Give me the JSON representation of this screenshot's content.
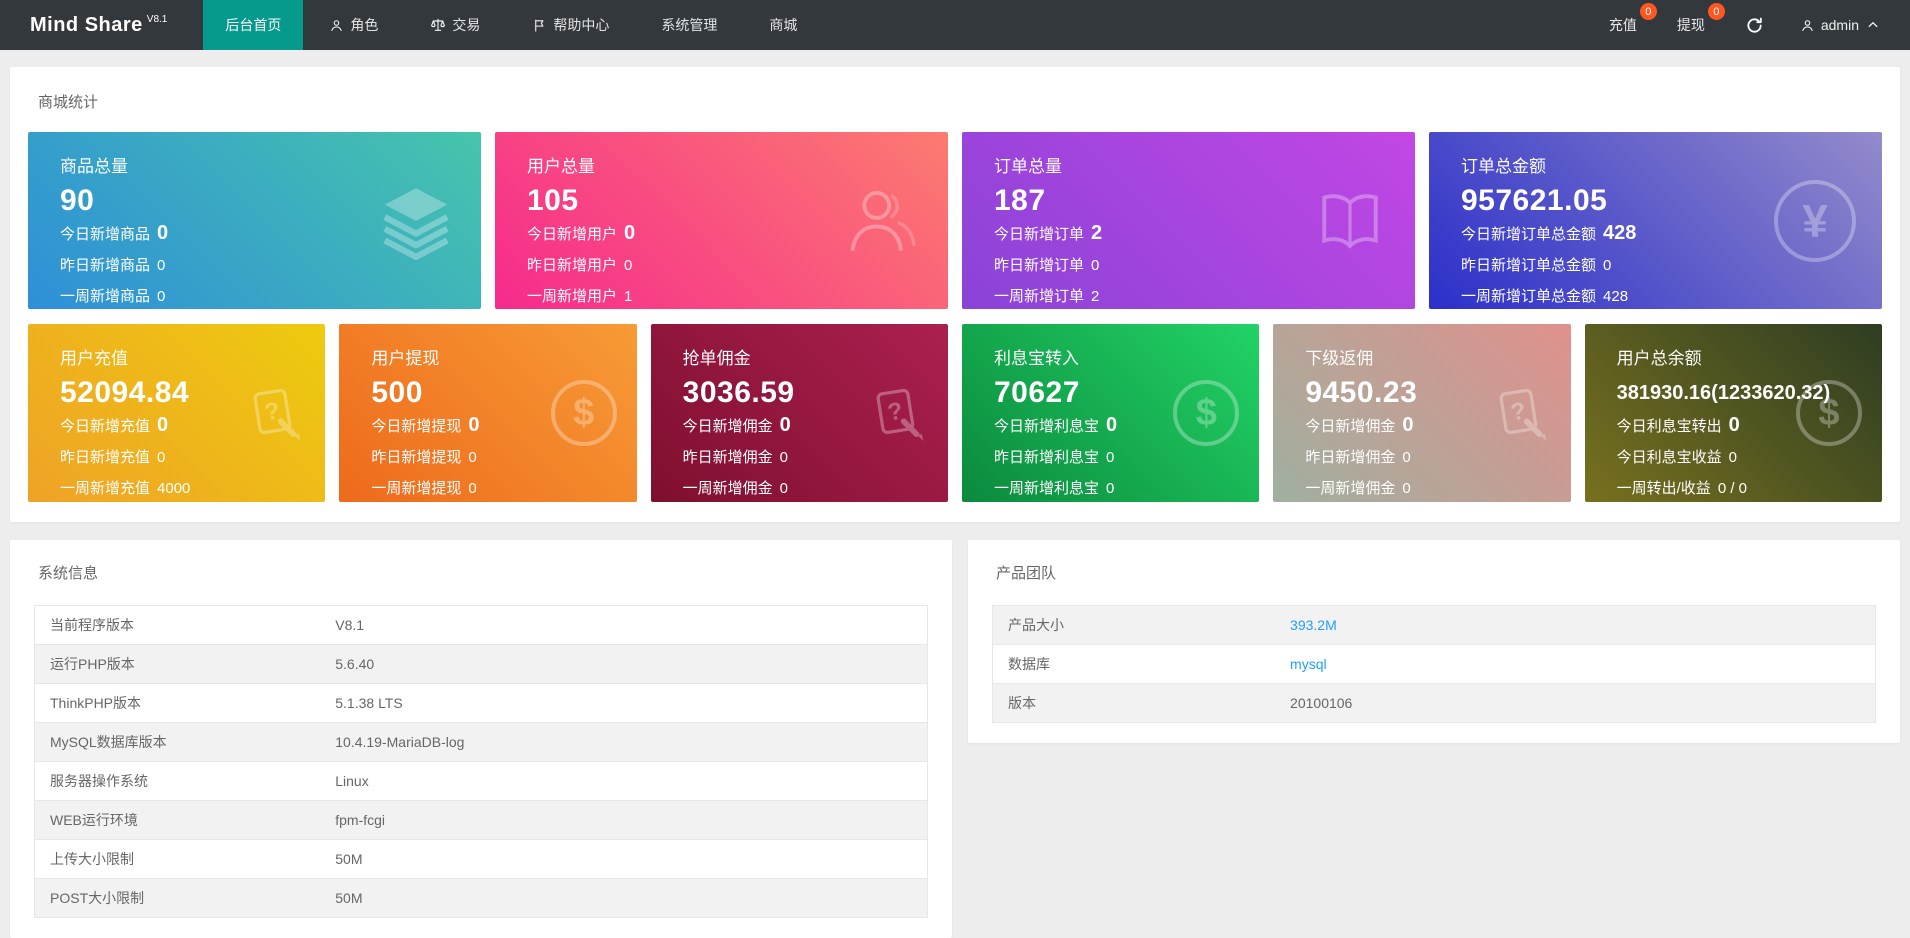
{
  "colors": {
    "navbar_bg": "#33383d",
    "nav_active_bg": "#069a8d",
    "badge_bg": "#ff5722",
    "link_blue": "#1e9fff",
    "page_bg": "#ededed"
  },
  "navbar": {
    "brand": "Mind Share",
    "brand_version": "V8.1",
    "menu": [
      {
        "name": "nav-home",
        "label": "后台首页",
        "icon": null,
        "active": true
      },
      {
        "name": "nav-roles",
        "label": "角色",
        "icon": "user",
        "active": false
      },
      {
        "name": "nav-trade",
        "label": "交易",
        "icon": "scales",
        "active": false
      },
      {
        "name": "nav-help",
        "label": "帮助中心",
        "icon": "flag",
        "active": false
      },
      {
        "name": "nav-system",
        "label": "系统管理",
        "icon": null,
        "active": false
      },
      {
        "name": "nav-mall",
        "label": "商城",
        "icon": null,
        "active": false
      }
    ],
    "actions": [
      {
        "name": "recharge",
        "label": "充值",
        "badge": "0"
      },
      {
        "name": "withdraw",
        "label": "提现",
        "badge": "0"
      }
    ],
    "user": {
      "name": "admin"
    }
  },
  "stats": {
    "title": "商城统计",
    "cards_row1": [
      {
        "name": "card-goods-total",
        "title": "商品总量",
        "value": "90",
        "icon": "layers",
        "gradient": "linear-gradient(45deg, #2e8fd8, #46c5ac)",
        "lines": [
          {
            "label": "今日新增商品",
            "value": "0",
            "strong": true
          },
          {
            "label": "昨日新增商品",
            "value": "0",
            "strong": false
          },
          {
            "label": "一周新增商品",
            "value": "0",
            "strong": false
          }
        ]
      },
      {
        "name": "card-users-total",
        "title": "用户总量",
        "value": "105",
        "icon": "users",
        "gradient": "linear-gradient(45deg, #f62a8d, #fc7b70)",
        "lines": [
          {
            "label": "今日新增用户",
            "value": "0",
            "strong": true
          },
          {
            "label": "昨日新增用户",
            "value": "0",
            "strong": false
          },
          {
            "label": "一周新增用户",
            "value": "1",
            "strong": false
          }
        ]
      },
      {
        "name": "card-orders-total",
        "title": "订单总量",
        "value": "187",
        "icon": "book",
        "gradient": "linear-gradient(45deg, #8a43d7, #c247e4)",
        "lines": [
          {
            "label": "今日新增订单",
            "value": "2",
            "strong": true
          },
          {
            "label": "昨日新增订单",
            "value": "0",
            "strong": false
          },
          {
            "label": "一周新增订单",
            "value": "2",
            "strong": false
          }
        ]
      },
      {
        "name": "card-order-amount",
        "title": "订单总金额",
        "value": "957621.05",
        "icon": "yen-circle",
        "gradient": "linear-gradient(45deg, #2b2fc9, #938bcb)",
        "lines": [
          {
            "label": "今日新增订单总金额",
            "value": "428",
            "strong": true
          },
          {
            "label": "昨日新增订单总金额",
            "value": "0",
            "strong": false
          },
          {
            "label": "一周新增订单总金额",
            "value": "428",
            "strong": false
          }
        ]
      }
    ],
    "cards_row2": [
      {
        "name": "card-user-recharge",
        "title": "用户充值",
        "value": "52094.84",
        "icon": "question-doc",
        "gradient": "linear-gradient(45deg, #efa227, #eecb0e)",
        "lines": [
          {
            "label": "今日新增充值",
            "value": "0",
            "strong": true
          },
          {
            "label": "昨日新增充值",
            "value": "0",
            "strong": false
          },
          {
            "label": "一周新增充值",
            "value": "4000",
            "strong": false
          }
        ]
      },
      {
        "name": "card-user-withdraw",
        "title": "用户提现",
        "value": "500",
        "icon": "dollar-circle",
        "gradient": "linear-gradient(45deg, #ee6a1c, #f79b36)",
        "lines": [
          {
            "label": "今日新增提现",
            "value": "0",
            "strong": true
          },
          {
            "label": "昨日新增提现",
            "value": "0",
            "strong": false
          },
          {
            "label": "一周新增提现",
            "value": "0",
            "strong": false
          }
        ]
      },
      {
        "name": "card-order-commission",
        "title": "抢单佣金",
        "value": "3036.59",
        "icon": "question-doc",
        "gradient": "linear-gradient(45deg, #7f0f2e, #ab2050)",
        "lines": [
          {
            "label": "今日新增佣金",
            "value": "0",
            "strong": true
          },
          {
            "label": "昨日新增佣金",
            "value": "0",
            "strong": false
          },
          {
            "label": "一周新增佣金",
            "value": "0",
            "strong": false
          }
        ]
      },
      {
        "name": "card-interest-in",
        "title": "利息宝转入",
        "value": "70627",
        "icon": "dollar-circle",
        "gradient": "linear-gradient(45deg, #0b8a3d, #22d366)",
        "lines": [
          {
            "label": "今日新增利息宝",
            "value": "0",
            "strong": true
          },
          {
            "label": "昨日新增利息宝",
            "value": "0",
            "strong": false
          },
          {
            "label": "一周新增利息宝",
            "value": "0",
            "strong": false
          }
        ]
      },
      {
        "name": "card-sub-rebate",
        "title": "下级返佣",
        "value": "9450.23",
        "icon": "question-doc",
        "gradient": "linear-gradient(45deg, #9fb09f, #e0918d)",
        "lines": [
          {
            "label": "今日新增佣金",
            "value": "0",
            "strong": true
          },
          {
            "label": "昨日新增佣金",
            "value": "0",
            "strong": false
          },
          {
            "label": "一周新增佣金",
            "value": "0",
            "strong": false
          }
        ]
      },
      {
        "name": "card-user-balance",
        "title": "用户总余额",
        "value": "381930.16(1233620.32)",
        "icon": "dollar-circle",
        "small_value": true,
        "gradient": "linear-gradient(45deg, #77701e, #2e3d22)",
        "lines": [
          {
            "label": "今日利息宝转出",
            "value": "0",
            "strong": true
          },
          {
            "label": "今日利息宝收益",
            "value": "0",
            "strong": false
          },
          {
            "label": "一周转出/收益",
            "value": "0 / 0",
            "strong": false
          }
        ]
      }
    ]
  },
  "system_info": {
    "title": "系统信息",
    "rows": [
      {
        "label": "当前程序版本",
        "value": "V8.1"
      },
      {
        "label": "运行PHP版本",
        "value": "5.6.40"
      },
      {
        "label": "ThinkPHP版本",
        "value": "5.1.38 LTS"
      },
      {
        "label": "MySQL数据库版本",
        "value": "10.4.19-MariaDB-log"
      },
      {
        "label": "服务器操作系统",
        "value": "Linux"
      },
      {
        "label": "WEB运行环境",
        "value": "fpm-fcgi"
      },
      {
        "label": "上传大小限制",
        "value": "50M"
      },
      {
        "label": "POST大小限制",
        "value": "50M"
      }
    ]
  },
  "product_team": {
    "title": "产品团队",
    "rows": [
      {
        "label": "产品大小",
        "value": "393.2M",
        "link": true
      },
      {
        "label": "数据库",
        "value": "mysql",
        "link": true
      },
      {
        "label": "版本",
        "value": "20100106",
        "link": false
      }
    ]
  }
}
